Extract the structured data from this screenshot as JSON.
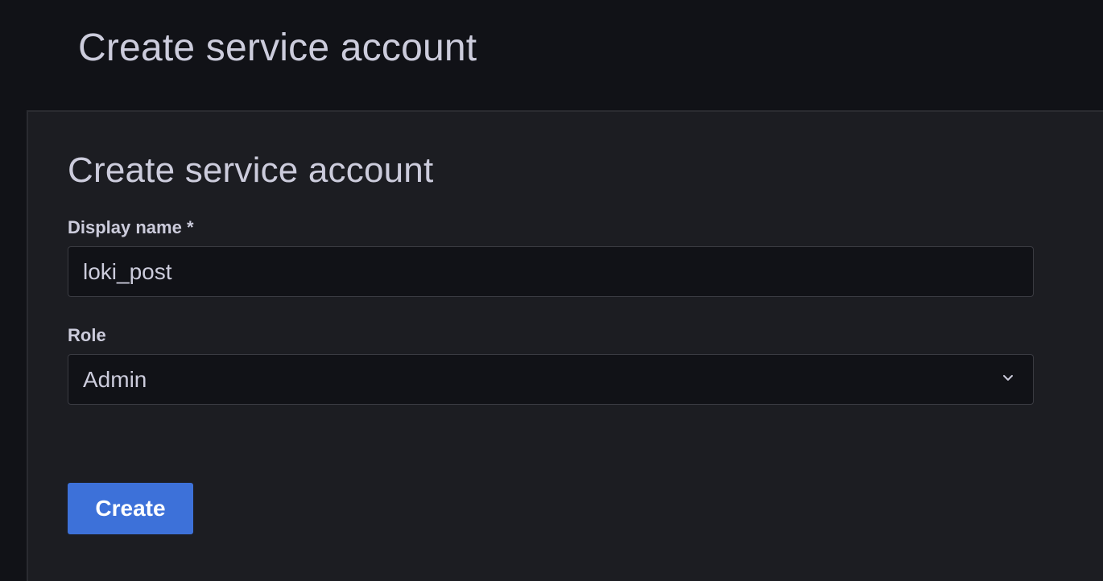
{
  "page": {
    "title": "Create service account"
  },
  "form": {
    "title": "Create service account",
    "display_name": {
      "label": "Display name *",
      "value": "loki_post"
    },
    "role": {
      "label": "Role",
      "selected": "Admin",
      "icon": "chevron-down-icon"
    },
    "submit_label": "Create"
  },
  "colors": {
    "background": "#111217",
    "panel": "#1c1d22",
    "primary": "#3d71d9",
    "text": "#ccccdc"
  }
}
